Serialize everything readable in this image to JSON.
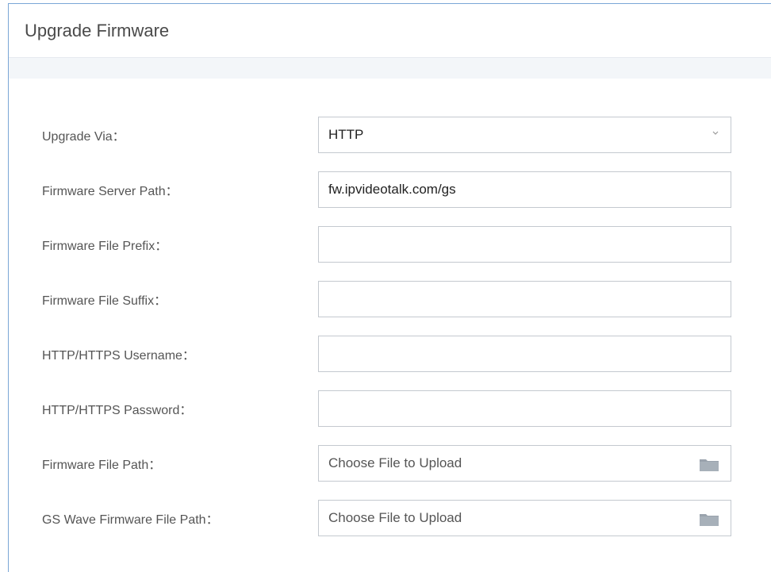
{
  "panel": {
    "title": "Upgrade Firmware"
  },
  "form": {
    "upgrade_via": {
      "label": "Upgrade Via：",
      "value": "HTTP"
    },
    "server_path": {
      "label": "Firmware Server Path：",
      "value": "fw.ipvideotalk.com/gs"
    },
    "file_prefix": {
      "label": "Firmware File Prefix：",
      "value": ""
    },
    "file_suffix": {
      "label": "Firmware File Suffix：",
      "value": ""
    },
    "username": {
      "label": "HTTP/HTTPS Username：",
      "value": ""
    },
    "password": {
      "label": "HTTP/HTTPS Password：",
      "value": ""
    },
    "file_path": {
      "label": "Firmware File Path：",
      "placeholder": "Choose File to Upload"
    },
    "gs_wave_path": {
      "label": "GS Wave Firmware File Path：",
      "placeholder": "Choose File to Upload"
    }
  },
  "icons": {
    "dropdown": "chevron-down-icon",
    "folder": "folder-icon"
  },
  "colors": {
    "border_accent": "#7aa6d6",
    "folder_icon": "#9aa3ad"
  }
}
